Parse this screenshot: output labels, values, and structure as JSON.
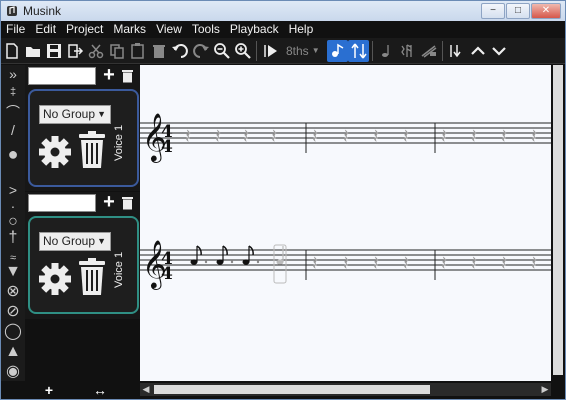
{
  "window": {
    "title": "Musink",
    "min": "−",
    "max": "□",
    "close": "✕"
  },
  "menu": [
    "File",
    "Edit",
    "Project",
    "Marks",
    "View",
    "Tools",
    "Playback",
    "Help"
  ],
  "toolbar": {
    "duration_value": "8ths"
  },
  "voices": [
    {
      "group": "No Group",
      "label": "Voice 1"
    },
    {
      "group": "No Group",
      "label": "Voice 1"
    }
  ],
  "score": {
    "time_signature_top": "4",
    "time_signature_bottom": "4"
  },
  "bottombar": {
    "add_label": "+",
    "resize_label": "↔"
  },
  "colors": {
    "accent": "#2a6fd1",
    "voice1_border": "#3b5a9c",
    "voice2_border": "#2f8f84"
  }
}
